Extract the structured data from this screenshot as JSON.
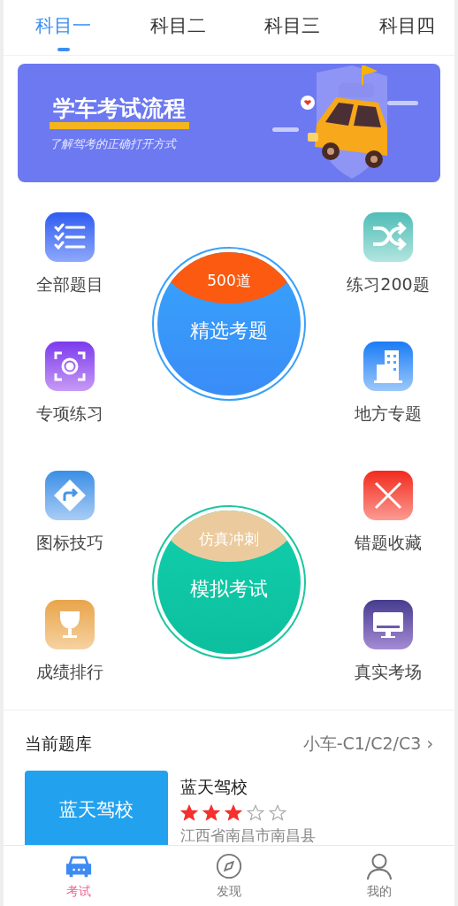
{
  "tabs": [
    {
      "label": "科目一",
      "selected": true
    },
    {
      "label": "科目二",
      "selected": false
    },
    {
      "label": "科目三",
      "selected": false
    },
    {
      "label": "科目四",
      "selected": false
    }
  ],
  "banner": {
    "title": "学车考试流程",
    "subtitle": "了解驾考的正确打开方式"
  },
  "features": [
    {
      "kind": "checklist",
      "label": "全部题目"
    },
    {
      "kind": "shuffle",
      "label": "练习200题"
    },
    {
      "kind": "scan",
      "label": "专项练习"
    },
    {
      "kind": "building",
      "label": "地方专题"
    },
    {
      "kind": "sign",
      "label": "图标技巧"
    },
    {
      "kind": "wrong",
      "label": "错题收藏"
    },
    {
      "kind": "trophy",
      "label": "成绩排行"
    },
    {
      "kind": "monitor",
      "label": "真实考场"
    }
  ],
  "circles": [
    {
      "kind": "blue",
      "badge": "500道",
      "label": "精选考题"
    },
    {
      "kind": "green",
      "badge": "仿真冲刺",
      "label": "模拟考试"
    }
  ],
  "question_bank": {
    "title": "当前题库",
    "vehicle": "小车-C1/C2/C3",
    "chevron": "›",
    "school": {
      "logo_text": "蓝天驾校",
      "name": "蓝天驾校",
      "stars": 3,
      "address": "江西省南昌市南昌县"
    }
  },
  "bottom_nav": [
    {
      "kind": "car",
      "label": "考试",
      "selected": true
    },
    {
      "kind": "compass",
      "label": "发现",
      "selected": false
    },
    {
      "kind": "person",
      "label": "我的",
      "selected": false
    }
  ]
}
